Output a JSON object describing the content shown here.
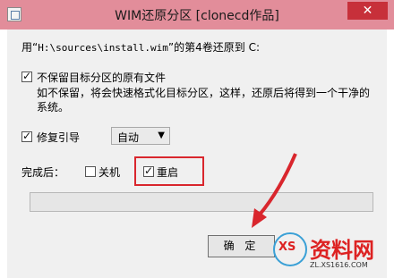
{
  "window": {
    "title": "WIM还原分区 [clonecd作品]",
    "close_glyph": "✕"
  },
  "restore_line": {
    "prefix": "用“",
    "path": "H:\\sources\\install.wim",
    "suffix": "”的第4卷还原到 C:"
  },
  "keep_files": {
    "checked": true,
    "label": "不保留目标分区的原有文件",
    "desc_line1": "如不保留，将会快速格式化目标分区，这样，还原后将得到一个干净的",
    "desc_line2": "系统。"
  },
  "repair_boot": {
    "checked": true,
    "label": "修复引导",
    "mode_selected": "自动"
  },
  "after_complete": {
    "label": "完成后：",
    "shutdown": {
      "checked": false,
      "label": "关机"
    },
    "restart": {
      "checked": true,
      "label": "重启"
    }
  },
  "progress": {
    "percent": 0
  },
  "ok_button": {
    "label": "确 定"
  },
  "watermark": {
    "logo_letters": "XS",
    "name": "资料网",
    "url": "ZL.XS1616.COM"
  },
  "colors": {
    "titlebar": "#e28d9a",
    "close": "#c7303a",
    "annotation_red": "#d9262d"
  }
}
